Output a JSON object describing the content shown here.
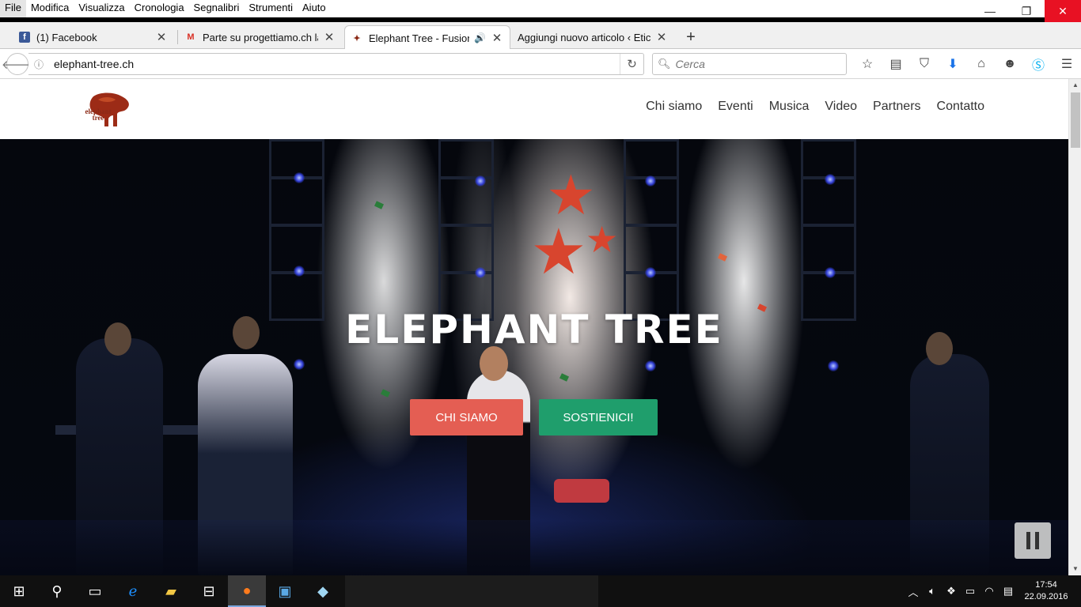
{
  "menubar": {
    "items": [
      "File",
      "Modifica",
      "Visualizza",
      "Cronologia",
      "Segnalibri",
      "Strumenti",
      "Aiuto"
    ]
  },
  "window_controls": {
    "minimize": "—",
    "restore": "❐",
    "close": "✕"
  },
  "tabs": [
    {
      "label": "(1) Facebook",
      "icon": "facebook-icon",
      "active": false
    },
    {
      "label": "Parte su progettiamo.ch la...",
      "icon": "gmail-icon",
      "active": false
    },
    {
      "label": "Elephant Tree - Fusion...",
      "icon": "elephant-tree-icon",
      "active": true,
      "audio": true
    },
    {
      "label": "Aggiungi nuovo articolo ‹ Etici...",
      "icon": "none",
      "active": false
    }
  ],
  "new_tab_label": "+",
  "navbar": {
    "url": "elephant-tree.ch",
    "search_placeholder": "Cerca"
  },
  "site": {
    "logo_text_line1": "elephant",
    "logo_text_line2": "tree",
    "nav": [
      "Chi siamo",
      "Eventi",
      "Musica",
      "Video",
      "Partners",
      "Contatto"
    ],
    "hero_title": "ELEPHANT TREE",
    "btn_primary": "CHI SIAMO",
    "btn_secondary": "SOSTIENICI!"
  },
  "colors": {
    "logo": "#8b2a16",
    "btn_primary": "#e45e53",
    "btn_secondary": "#1f9e6c",
    "close_button": "#e81123"
  },
  "taskbar": {
    "clock_time": "17:54",
    "clock_date": "22.09.2016"
  }
}
